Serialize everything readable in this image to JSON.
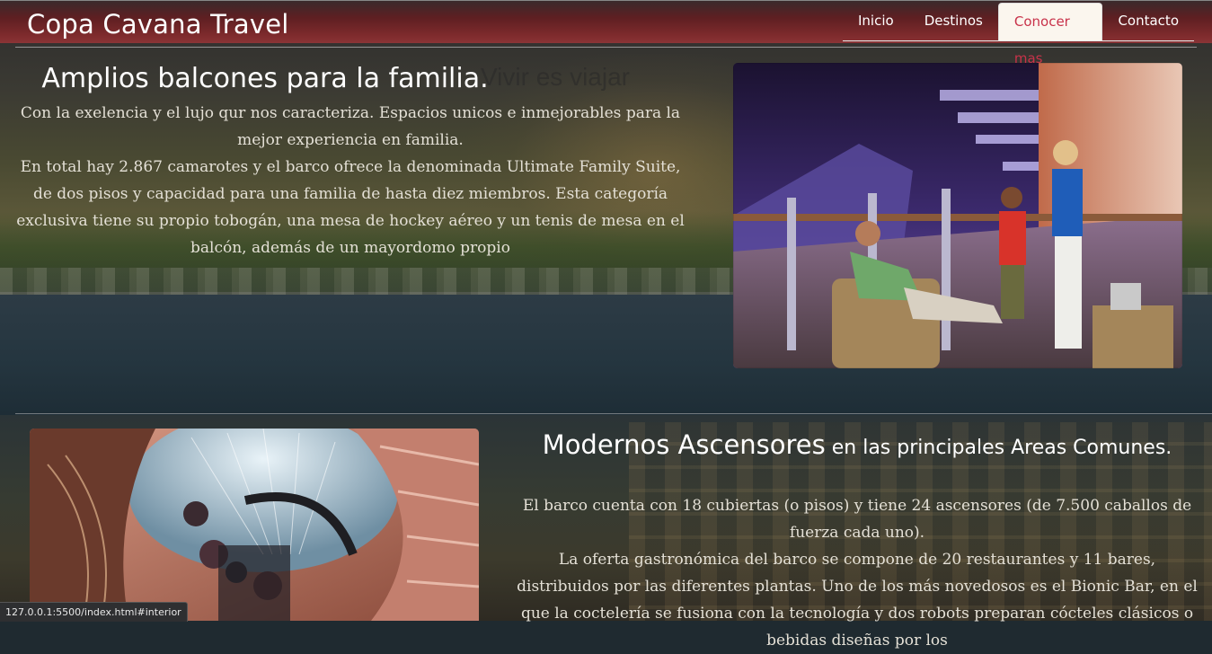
{
  "navbar": {
    "brand": "Copa Cavana Travel",
    "items": [
      {
        "label": "Inicio",
        "active": false
      },
      {
        "label": "Destinos",
        "active": false
      },
      {
        "label": "Conocer mas",
        "active": true
      },
      {
        "label": "Contacto",
        "active": false
      }
    ]
  },
  "background": {
    "watermark": "Vivir es viajar"
  },
  "section1": {
    "title": "Amplios balcones para la familia.",
    "paragraph1": "Con la exelencia y el lujo qur nos caracteriza. Espacios unicos e inmejorables para la mejor experiencia en familia.",
    "paragraph2": "En total hay 2.867 camarotes y el barco ofrece la denominada Ultimate Family Suite, de dos pisos y capacidad para una familia de hasta diez miembros. Esta categoría exclusiva tiene su propio tobogán, una mesa de hockey aéreo y un tenis de mesa en el balcón, además de un mayordomo propio"
  },
  "section2": {
    "title_big": "Modernos Ascensores",
    "title_small": " en las principales Areas Comunes.",
    "paragraph1": "El barco cuenta con 18 cubiertas (o pisos) y tiene 24 ascensores (de 7.500 caballos de fuerza cada uno).",
    "paragraph2": "La oferta gastronómica del barco se compone de 20 restaurantes y 11 bares, distribuidos por las diferentes plantas. Uno de los más novedosos es el Bionic Bar, en el que la coctelería se fusiona con la tecnología y dos robots preparan cócteles clásicos o bebidas diseñas por los"
  },
  "statusbar": {
    "url": "127.0.0.1:5500/index.html#interior"
  },
  "colors": {
    "navbar": "#6e2426",
    "active_tab_bg": "#fbf6ee",
    "active_tab_text": "#c8324a"
  }
}
